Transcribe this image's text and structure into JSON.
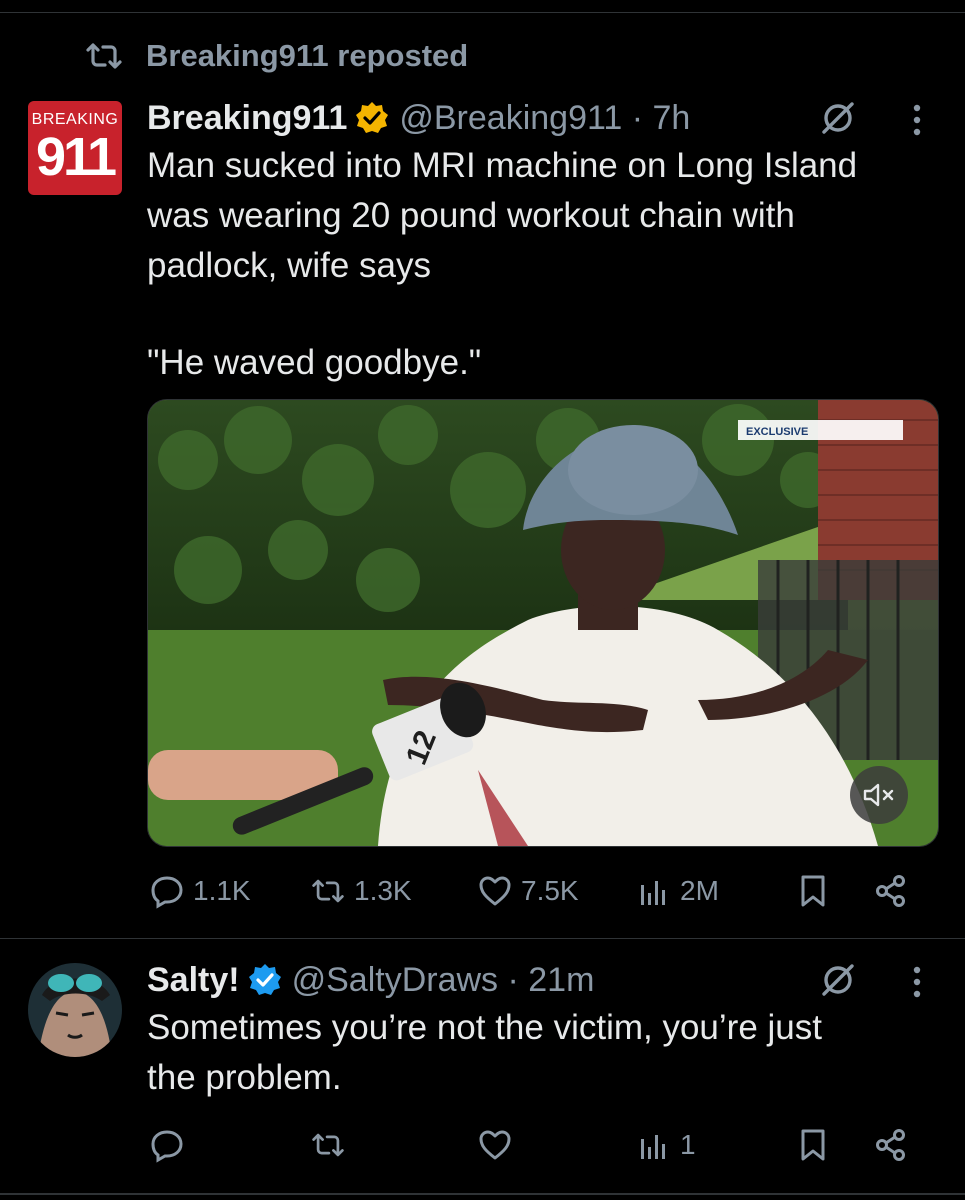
{
  "repost": {
    "label": "Breaking911 reposted",
    "icon": "repost-icon"
  },
  "tweet": {
    "avatar_text_top": "BREAKING",
    "avatar_text_main": "911",
    "display_name": "Breaking911",
    "handle_time": "@Breaking911 · 7h",
    "text_line1": "Man sucked into MRI machine on Long Island",
    "text_line2": "was wearing 20 pound workout chain with",
    "text_line3": "padlock, wife says",
    "quote": "\"He waved goodbye.\"",
    "media": {
      "overlay_tag": "EXCLUSIVE",
      "mic_flag": "12",
      "mute_icon": "mute-icon"
    },
    "stats": {
      "replies": "1.1K",
      "reposts": "1.3K",
      "likes": "7.5K",
      "views": "2M"
    }
  },
  "reply": {
    "display_name": "Salty!",
    "handle_time": "@SaltyDraws · 21m",
    "text_line1": "Sometimes you’re not the victim, you’re just",
    "text_line2": "the problem.",
    "stats": {
      "views": "1"
    }
  },
  "colors": {
    "background": "#000000",
    "text": "#e7e9ea",
    "muted": "#8b98a5",
    "gold_badge": "#f4b400",
    "blue_badge": "#1d9bf0",
    "brand_red": "#c8222c"
  }
}
